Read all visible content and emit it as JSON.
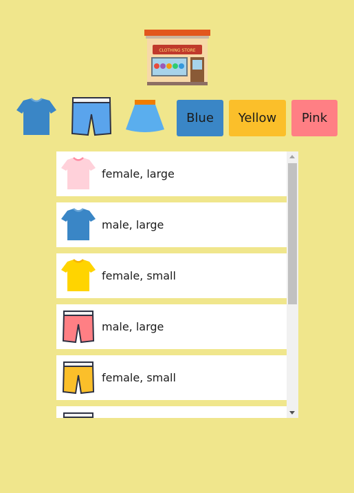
{
  "store": {
    "sign_text": "CLOTHING STORE"
  },
  "filters": {
    "types": [
      {
        "icon": "tshirt-icon"
      },
      {
        "icon": "shorts-icon"
      },
      {
        "icon": "skirt-icon"
      }
    ],
    "colors": [
      {
        "label": "Blue",
        "bg": "#3a86c6"
      },
      {
        "label": "Yellow",
        "bg": "#fbbf2a"
      },
      {
        "label": "Pink",
        "bg": "#ff7f84"
      }
    ]
  },
  "items": [
    {
      "icon": "tshirt-icon",
      "color": "#ffd1da",
      "label": "female, large"
    },
    {
      "icon": "tshirt-icon",
      "color": "#3a86c6",
      "label": "male, large"
    },
    {
      "icon": "tshirt-icon",
      "color": "#ffd400",
      "label": "female, small"
    },
    {
      "icon": "shorts-icon",
      "color": "#ff7f84",
      "label": "male, large"
    },
    {
      "icon": "shorts-icon",
      "color": "#fbbf2a",
      "label": "female, small"
    },
    {
      "icon": "shorts-icon",
      "color": "#ffd1da",
      "label": ""
    }
  ]
}
